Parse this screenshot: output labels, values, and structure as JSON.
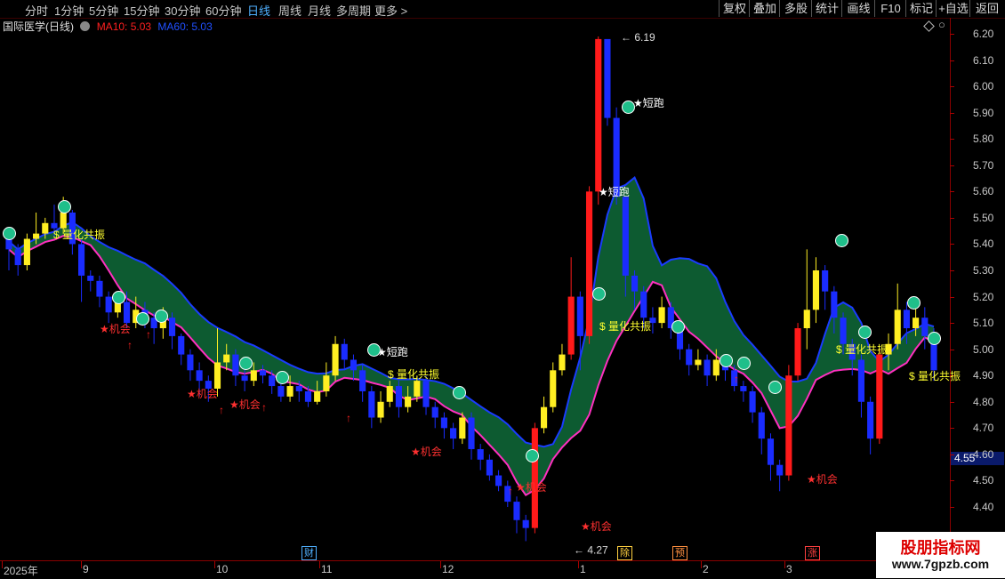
{
  "toolbar": {
    "periods": [
      "分时",
      "1分钟",
      "5分钟",
      "15分钟",
      "30分钟",
      "60分钟",
      "日线",
      "周线",
      "月线",
      "多周期",
      "更多"
    ],
    "active_period": "日线",
    "tools": [
      "复权",
      "叠加",
      "多股",
      "统计",
      "画线",
      "F10",
      "标记",
      "+自选",
      "返回"
    ]
  },
  "legend": {
    "title": "国际医学(日线)",
    "ma10_label": "MA10: 5.03",
    "ma60_label": "MA60: 5.03",
    "ma10_color": "#ff2020",
    "ma60_color": "#2040ff"
  },
  "price_axis": {
    "ticks": [
      "6.20",
      "6.10",
      "6.00",
      "5.90",
      "5.80",
      "5.70",
      "5.60",
      "5.50",
      "5.40",
      "5.30",
      "5.20",
      "5.10",
      "5.00",
      "4.90",
      "4.80",
      "4.70",
      "4.60",
      "4.50",
      "4.40"
    ],
    "current_price": "4.55"
  },
  "time_axis": {
    "labels": [
      "2025年",
      "9",
      "10",
      "11",
      "12",
      "1",
      "2",
      "3"
    ]
  },
  "event_markers": [
    {
      "text": "财",
      "color": "#4fb0ff"
    },
    {
      "text": "除",
      "color": "#ffd040"
    },
    {
      "text": "预",
      "color": "#ff9040"
    },
    {
      "text": "涨",
      "color": "#ff4040"
    }
  ],
  "annotations": {
    "high": "6.19",
    "low": "4.27",
    "signals": [
      "量化共振",
      "量化共振",
      "量化共振",
      "量化共振",
      "量化共振",
      "短跑",
      "短跑",
      "短跑",
      "机会",
      "机会",
      "机会",
      "机会",
      "机会",
      "机会",
      "机会"
    ]
  },
  "watermark": {
    "line1": "股朋指标网",
    "line2": "www.7gpzb.com"
  },
  "chart_data": {
    "type": "candlestick",
    "title": "国际医学(日线)",
    "ylim": [
      4.27,
      6.25
    ],
    "series": [
      {
        "name": "MA10",
        "last": 5.03
      },
      {
        "name": "MA60",
        "last": 5.03
      }
    ],
    "candles": [
      [
        5.45,
        5.38,
        5.46,
        5.3
      ],
      [
        5.38,
        5.32,
        5.4,
        5.28
      ],
      [
        5.32,
        5.42,
        5.44,
        5.3
      ],
      [
        5.42,
        5.44,
        5.52,
        5.4
      ],
      [
        5.44,
        5.48,
        5.5,
        5.42
      ],
      [
        5.48,
        5.46,
        5.55,
        5.43
      ],
      [
        5.46,
        5.52,
        5.58,
        5.44
      ],
      [
        5.52,
        5.4,
        5.53,
        5.36
      ],
      [
        5.4,
        5.28,
        5.42,
        5.18
      ],
      [
        5.28,
        5.26,
        5.3,
        5.22
      ],
      [
        5.26,
        5.2,
        5.28,
        5.16
      ],
      [
        5.2,
        5.14,
        5.22,
        5.1
      ],
      [
        5.14,
        5.18,
        5.2,
        5.12
      ],
      [
        5.18,
        5.1,
        5.22,
        5.08
      ],
      [
        5.1,
        5.15,
        5.2,
        5.08
      ],
      [
        5.15,
        5.12,
        5.18,
        5.08
      ],
      [
        5.12,
        5.08,
        5.14,
        5.02
      ],
      [
        5.08,
        5.12,
        5.16,
        5.04
      ],
      [
        5.12,
        5.05,
        5.14,
        5.0
      ],
      [
        5.05,
        4.98,
        5.06,
        4.94
      ],
      [
        4.98,
        4.92,
        5.0,
        4.88
      ],
      [
        4.92,
        4.88,
        4.95,
        4.82
      ],
      [
        4.88,
        4.85,
        4.9,
        4.8
      ],
      [
        4.85,
        4.95,
        5.08,
        4.82
      ],
      [
        4.95,
        4.98,
        5.02,
        4.92
      ],
      [
        4.98,
        4.9,
        5.0,
        4.86
      ],
      [
        4.9,
        4.88,
        4.93,
        4.84
      ],
      [
        4.88,
        4.92,
        4.95,
        4.86
      ],
      [
        4.92,
        4.9,
        4.94,
        4.87
      ],
      [
        4.9,
        4.86,
        4.92,
        4.83
      ],
      [
        4.86,
        4.82,
        4.88,
        4.8
      ],
      [
        4.82,
        4.86,
        4.9,
        4.8
      ],
      [
        4.86,
        4.84,
        4.88,
        4.8
      ],
      [
        4.84,
        4.8,
        4.86,
        4.78
      ],
      [
        4.8,
        4.84,
        4.88,
        4.79
      ],
      [
        4.84,
        4.9,
        4.95,
        4.82
      ],
      [
        4.9,
        5.02,
        5.05,
        4.88
      ],
      [
        5.02,
        4.96,
        5.04,
        4.92
      ],
      [
        4.96,
        4.92,
        4.98,
        4.88
      ],
      [
        4.92,
        4.84,
        4.94,
        4.8
      ],
      [
        4.84,
        4.74,
        4.86,
        4.7
      ],
      [
        4.74,
        4.8,
        4.84,
        4.72
      ],
      [
        4.8,
        4.86,
        4.88,
        4.78
      ],
      [
        4.86,
        4.78,
        4.88,
        4.74
      ],
      [
        4.78,
        4.82,
        4.86,
        4.76
      ],
      [
        4.82,
        4.88,
        4.9,
        4.8
      ],
      [
        4.88,
        4.78,
        4.9,
        4.75
      ],
      [
        4.78,
        4.74,
        4.8,
        4.7
      ],
      [
        4.74,
        4.7,
        4.76,
        4.66
      ],
      [
        4.7,
        4.66,
        4.72,
        4.62
      ],
      [
        4.66,
        4.74,
        4.76,
        4.64
      ],
      [
        4.74,
        4.62,
        4.76,
        4.58
      ],
      [
        4.62,
        4.58,
        4.64,
        4.54
      ],
      [
        4.58,
        4.52,
        4.6,
        4.5
      ],
      [
        4.52,
        4.48,
        4.54,
        4.46
      ],
      [
        4.48,
        4.42,
        4.5,
        4.4
      ],
      [
        4.42,
        4.35,
        4.44,
        4.3
      ],
      [
        4.35,
        4.32,
        4.37,
        4.27
      ],
      [
        4.32,
        4.7,
        4.72,
        4.3
      ],
      [
        4.7,
        4.78,
        4.82,
        4.68
      ],
      [
        4.78,
        4.92,
        4.95,
        4.76
      ],
      [
        4.92,
        4.98,
        5.02,
        4.9
      ],
      [
        4.98,
        5.2,
        5.35,
        4.96
      ],
      [
        5.2,
        5.05,
        5.22,
        4.92
      ],
      [
        5.05,
        5.6,
        5.62,
        5.02
      ],
      [
        5.6,
        6.18,
        6.19,
        5.55
      ],
      [
        6.18,
        5.88,
        6.1,
        5.85
      ],
      [
        5.88,
        5.58,
        5.92,
        5.55
      ],
      [
        5.58,
        5.28,
        5.45,
        5.2
      ],
      [
        5.28,
        5.22,
        5.3,
        5.15
      ],
      [
        5.22,
        5.12,
        5.24,
        5.08
      ],
      [
        5.12,
        5.1,
        5.16,
        5.06
      ],
      [
        5.1,
        5.16,
        5.2,
        5.08
      ],
      [
        5.16,
        5.08,
        5.18,
        5.04
      ],
      [
        5.08,
        5.0,
        5.1,
        4.96
      ],
      [
        5.0,
        4.94,
        5.02,
        4.9
      ],
      [
        4.94,
        4.96,
        5.0,
        4.92
      ],
      [
        4.96,
        4.9,
        4.98,
        4.86
      ],
      [
        4.9,
        4.96,
        5.0,
        4.88
      ],
      [
        4.96,
        4.92,
        4.98,
        4.88
      ],
      [
        4.92,
        4.86,
        4.94,
        4.84
      ],
      [
        4.86,
        4.84,
        4.88,
        4.8
      ],
      [
        4.84,
        4.76,
        4.86,
        4.72
      ],
      [
        4.76,
        4.66,
        4.78,
        4.6
      ],
      [
        4.66,
        4.56,
        4.68,
        4.5
      ],
      [
        4.56,
        4.52,
        4.58,
        4.46
      ],
      [
        4.52,
        4.9,
        4.94,
        4.5
      ],
      [
        4.9,
        5.08,
        5.1,
        4.88
      ],
      [
        5.08,
        5.15,
        5.38,
        5.0
      ],
      [
        5.15,
        5.3,
        5.35,
        5.1
      ],
      [
        5.3,
        5.22,
        5.32,
        5.15
      ],
      [
        5.22,
        5.12,
        5.24,
        5.06
      ],
      [
        5.12,
        5.02,
        5.14,
        4.98
      ],
      [
        5.02,
        4.96,
        5.04,
        4.9
      ],
      [
        4.96,
        4.8,
        4.98,
        4.74
      ],
      [
        4.8,
        4.66,
        4.82,
        4.6
      ],
      [
        4.66,
        4.98,
        5.0,
        4.64
      ],
      [
        4.98,
        5.02,
        5.06,
        4.92
      ],
      [
        5.02,
        5.15,
        5.25,
        5.0
      ],
      [
        5.15,
        5.08,
        5.18,
        5.02
      ],
      [
        5.08,
        5.12,
        5.2,
        5.05
      ],
      [
        5.12,
        5.05,
        5.16,
        5.0
      ],
      [
        5.05,
        4.92,
        5.08,
        4.88
      ]
    ]
  }
}
